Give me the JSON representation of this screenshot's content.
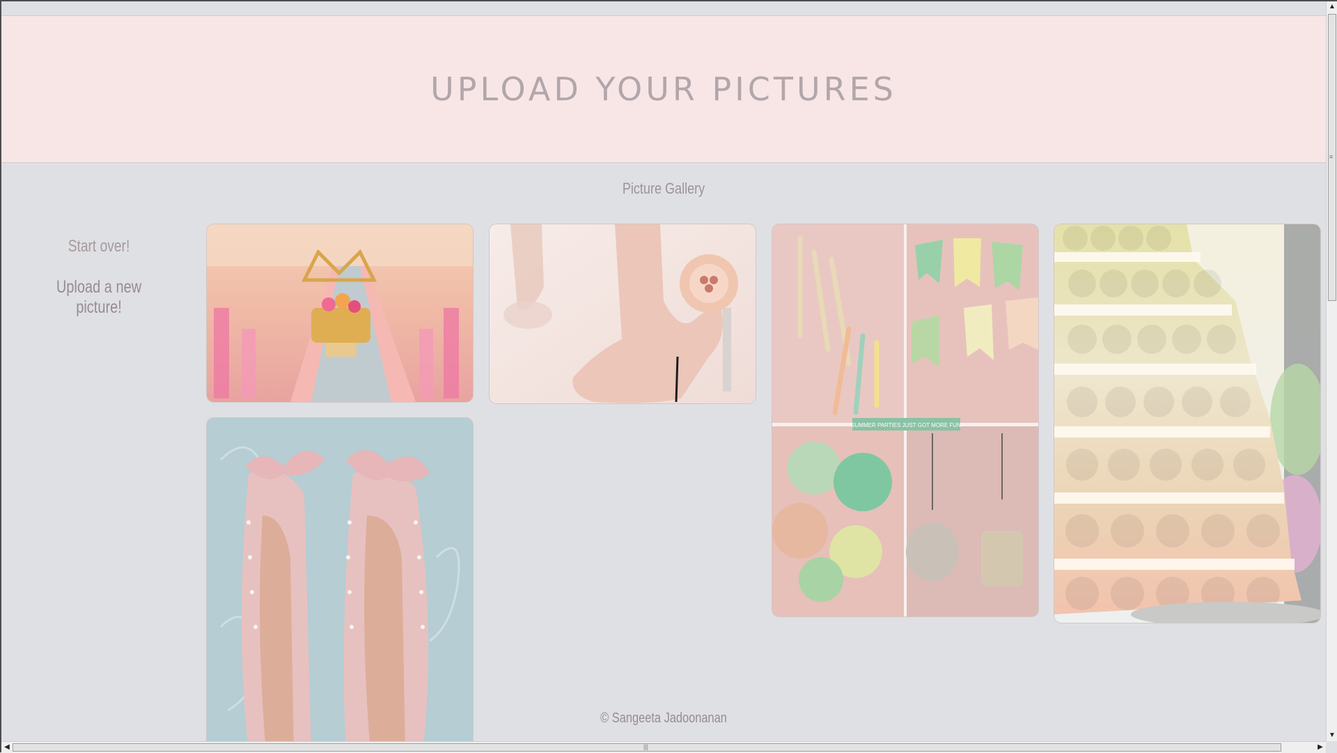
{
  "header": {
    "title": "UPLOAD YOUR PICTURES"
  },
  "gallery": {
    "title": "Picture Gallery",
    "photos": [
      {
        "name": "pink-table-setting"
      },
      {
        "name": "pink-flower-heel"
      },
      {
        "name": "summer-party-collage",
        "caption": "SUMMER PARTIES JUST GOT MORE FUN"
      },
      {
        "name": "cake-ball-tower"
      },
      {
        "name": "pink-bow-shoes"
      }
    ]
  },
  "sidebar": {
    "start_over": "Start over!",
    "upload_new": "Upload a new picture!"
  },
  "footer": {
    "copyright": "© Sangeeta Jadoonanan"
  },
  "colors": {
    "page_bg": "#dfe0e4",
    "header_bg": "#f8e6e7",
    "text": "#a69a9d"
  }
}
